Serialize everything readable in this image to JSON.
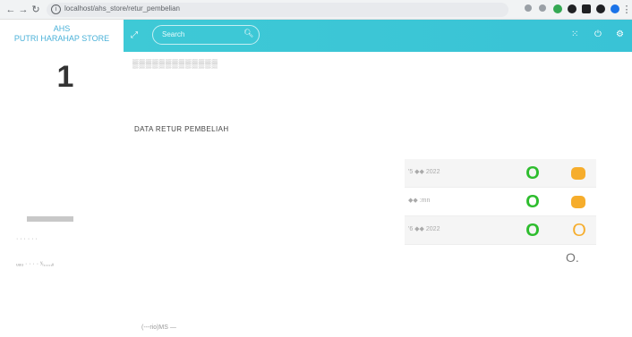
{
  "browser": {
    "address": "localhost/ahs_store/retur_pembelian",
    "back_label": "←",
    "forward_label": "→",
    "reload_label": "↻"
  },
  "brand": {
    "line1": "AHS",
    "line2": "PUTRI HARAHAP STORE"
  },
  "header": {
    "search_placeholder": "Search"
  },
  "sidebar": {
    "number": "1",
    "items": [
      "· · · · · ·",
      "ᵤᵤᵤ · · · · ʸᵢ,,,,,ᵢᵢ"
    ]
  },
  "breadcrumb": "▒▒▒▒▒▒▒▒▒▒▒▒▒",
  "page_title": "DATA RETUR PEMBELIAH",
  "table": {
    "rows": [
      {
        "date": "'5 ◆◆ 2022"
      },
      {
        "date": "◆◆ :mn"
      },
      {
        "date": "'6 ◆◆ 2022"
      }
    ]
  },
  "footer": "(---rio)MS —",
  "colors": {
    "header": "#3ec9d6",
    "brand": "#4ab1d8",
    "accept": "#2ebd2e",
    "edit": "#f6ad2c"
  }
}
